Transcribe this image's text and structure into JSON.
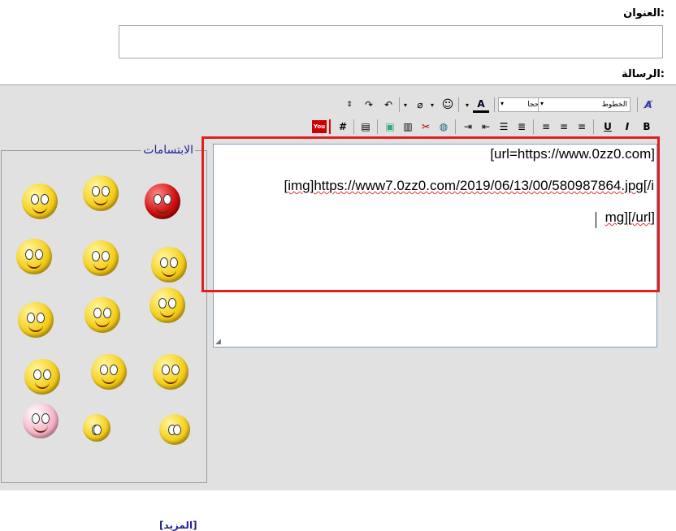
{
  "form": {
    "title_label": "العنوان:",
    "message_label": "الرسالة:"
  },
  "toolbar": {
    "font_select": "الخطوط",
    "size_select": "الأحجا",
    "bold": "B",
    "italic": "I",
    "underline": "U",
    "hash": "#"
  },
  "editor": {
    "line1_a": "[url=",
    "line1_b": "https://www.0zz0.com",
    "line1_c": "]",
    "line2_a": "[img]",
    "line2_b": "https://www7.0zz0.com/2019/06/13/00/580987864.jpg",
    "line2_c": "[/i",
    "line3_a": "mg][/url]"
  },
  "smilies": {
    "legend": "الابتسامات",
    "more_link": "[المزيد]"
  },
  "colors": {
    "panel_bg": "#e1e1e1",
    "highlight": "#e02020",
    "link": "#22229c"
  }
}
